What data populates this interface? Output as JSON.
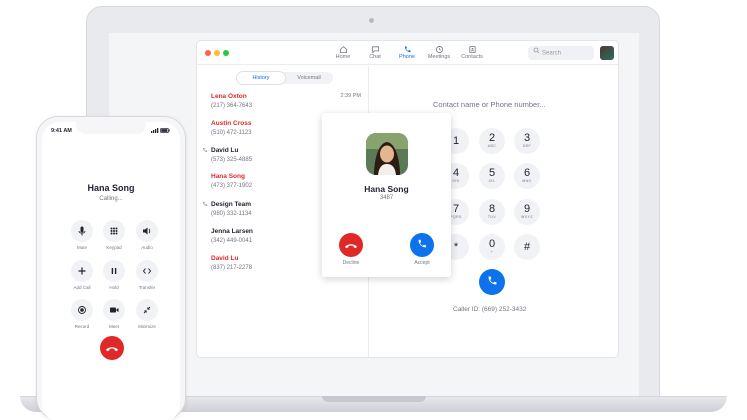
{
  "app": {
    "nav": [
      {
        "label": "Home",
        "icon": "home-icon"
      },
      {
        "label": "Chat",
        "icon": "chat-icon"
      },
      {
        "label": "Phone",
        "icon": "phone-icon"
      },
      {
        "label": "Meetings",
        "icon": "clock-icon"
      },
      {
        "label": "Contacts",
        "icon": "contacts-icon"
      }
    ],
    "search_placeholder": "Search",
    "tabs": {
      "history": "History",
      "voicemail": "Voicemail"
    },
    "history": [
      {
        "name": "Lena Oxton",
        "number": "(217) 364-7643",
        "time": "2:39 PM",
        "missed": true,
        "outgoing": false
      },
      {
        "name": "Austin Cross",
        "number": "(510) 472-1123",
        "time": "",
        "missed": true,
        "outgoing": false
      },
      {
        "name": "David Lu",
        "number": "(573) 325-4885",
        "time": "",
        "missed": false,
        "outgoing": true
      },
      {
        "name": "Hana Song",
        "number": "(473) 377-1902",
        "time": "",
        "missed": true,
        "outgoing": false
      },
      {
        "name": "Design Team",
        "number": "(980) 332-1134",
        "time": "",
        "missed": false,
        "outgoing": true
      },
      {
        "name": "Jenna Larsen",
        "number": "(342) 449-0041",
        "time": "",
        "missed": false,
        "outgoing": false
      },
      {
        "name": "David Lu",
        "number": "(837) 217-2278",
        "time": "",
        "missed": true,
        "outgoing": false
      }
    ],
    "contact_input": "Contact name or Phone number...",
    "keypad": [
      {
        "digit": "1",
        "letters": ""
      },
      {
        "digit": "2",
        "letters": "ABC"
      },
      {
        "digit": "3",
        "letters": "DEF"
      },
      {
        "digit": "4",
        "letters": "GHI"
      },
      {
        "digit": "5",
        "letters": "JKL"
      },
      {
        "digit": "6",
        "letters": "MNO"
      },
      {
        "digit": "7",
        "letters": "PQRS"
      },
      {
        "digit": "8",
        "letters": "TUV"
      },
      {
        "digit": "9",
        "letters": "WXYZ"
      },
      {
        "digit": "*",
        "letters": ""
      },
      {
        "digit": "0",
        "letters": "+"
      },
      {
        "digit": "#",
        "letters": ""
      }
    ],
    "caller_id": "Caller ID: (669) 252-3432"
  },
  "incoming": {
    "name": "Hana Song",
    "extension": "3487",
    "decline_label": "Decline",
    "accept_label": "Accept"
  },
  "phone": {
    "time": "9:41 AM",
    "caller_name": "Hana Song",
    "status": "Calling...",
    "controls": [
      {
        "label": "Mute",
        "icon": "microphone-icon"
      },
      {
        "label": "Keypad",
        "icon": "keypad-icon"
      },
      {
        "label": "Audio",
        "icon": "speaker-icon"
      },
      {
        "label": "Add Call",
        "icon": "plus-icon"
      },
      {
        "label": "Hold",
        "icon": "pause-icon"
      },
      {
        "label": "Transfer",
        "icon": "transfer-icon"
      },
      {
        "label": "Record",
        "icon": "record-icon"
      },
      {
        "label": "Meet",
        "icon": "video-icon"
      },
      {
        "label": "Minimize",
        "icon": "minimize-icon"
      }
    ]
  },
  "colors": {
    "accent": "#0e72ed",
    "danger": "#e02828",
    "text": "#232333",
    "muted": "#747487"
  }
}
